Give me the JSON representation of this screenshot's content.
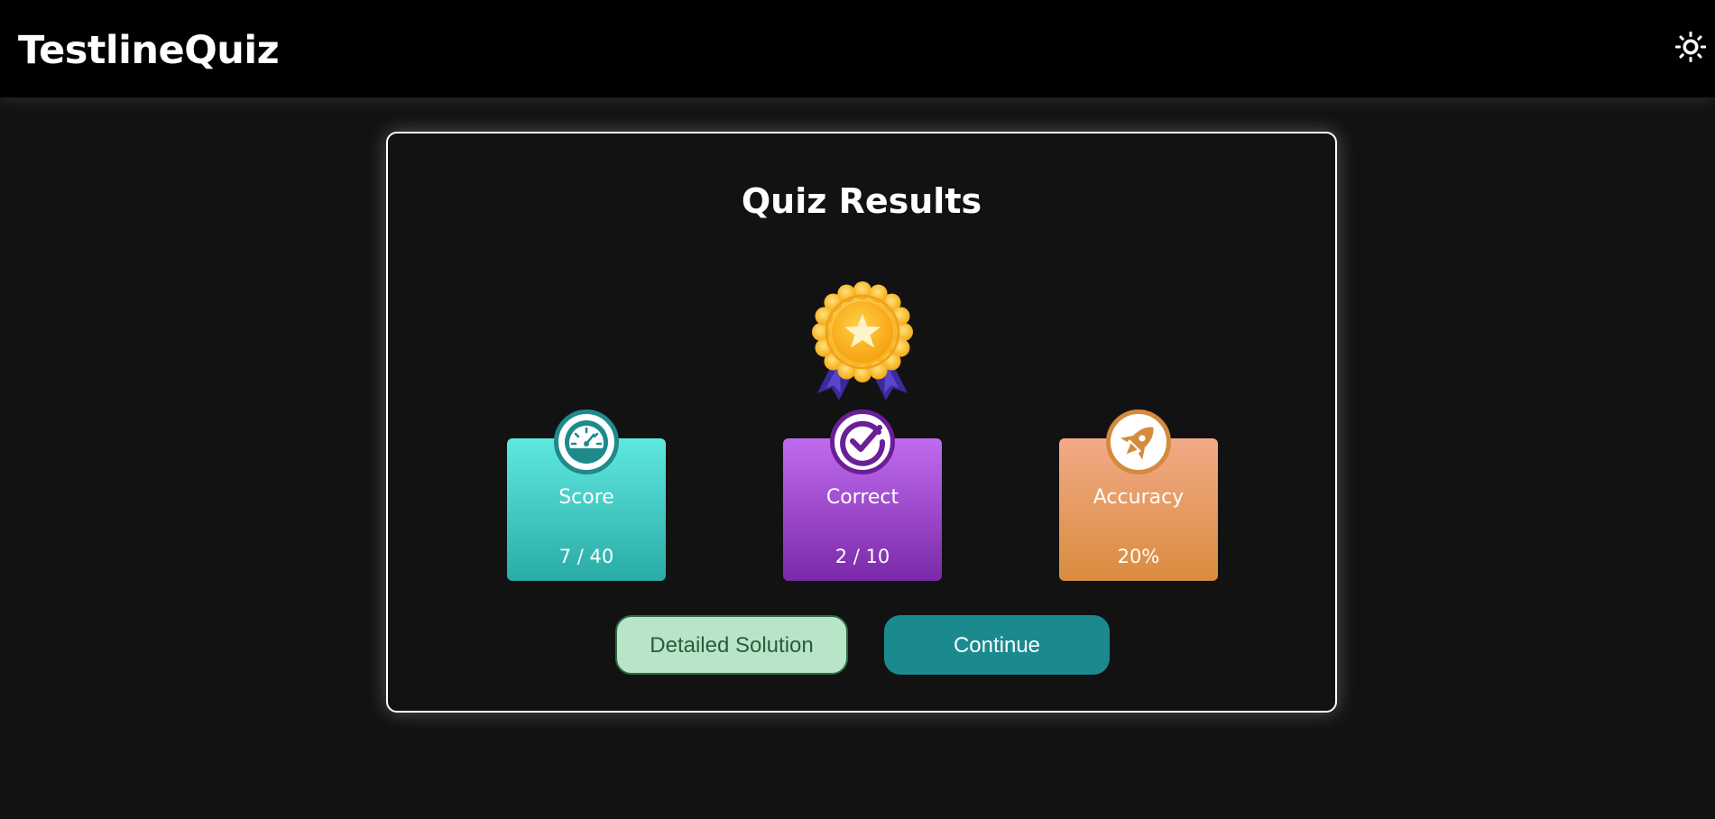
{
  "app": {
    "brand": "TestlineQuiz",
    "theme_toggle_icon": "sun-icon"
  },
  "results": {
    "title": "Quiz Results",
    "badge_icon": "medal-star-icon",
    "stats": [
      {
        "label": "Score",
        "value": "7 / 40",
        "icon": "speedometer-icon",
        "color": "#2aaba6"
      },
      {
        "label": "Correct",
        "value": "2 / 10",
        "icon": "check-circle-icon",
        "color": "#7a2aa9"
      },
      {
        "label": "Accuracy",
        "value": "20%",
        "icon": "rocket-icon",
        "color": "#d98c3e"
      }
    ],
    "buttons": {
      "detailed_solution": "Detailed Solution",
      "continue": "Continue"
    }
  },
  "colors": {
    "background": "#121212",
    "topbar": "#000000",
    "continue_button": "#1a8a8e",
    "detail_button": "#b8e4c8"
  }
}
